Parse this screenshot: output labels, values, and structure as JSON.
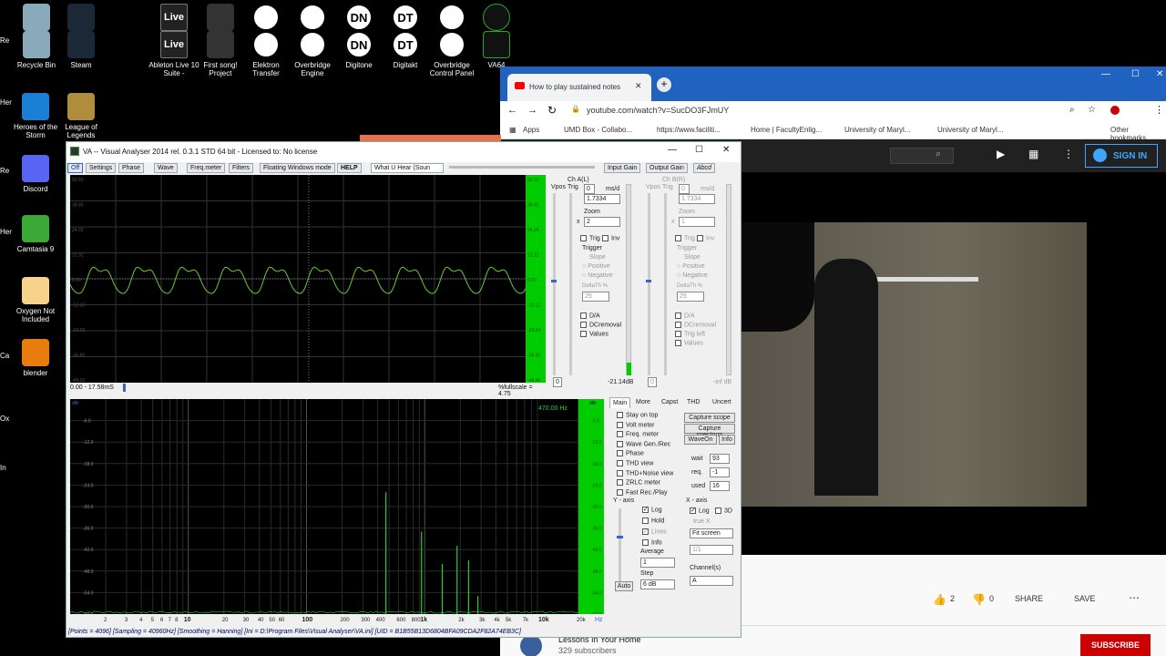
{
  "desktop": {
    "icons": [
      {
        "label": "Recycle Bin",
        "icon": "recycle-bin-icon"
      },
      {
        "label": "Steam",
        "icon": "steam-icon"
      },
      {
        "label": "Ableton Live 10 Suite -",
        "icon": "live-icon",
        "glyph": "Live"
      },
      {
        "label": "First song! Project",
        "icon": "project-file-icon"
      },
      {
        "label": "Elektron Transfer",
        "icon": "waveform-icon"
      },
      {
        "label": "Overbridge Engine",
        "icon": "overbridge-icon"
      },
      {
        "label": "Digitone",
        "icon": "digitone-icon",
        "glyph": "DN"
      },
      {
        "label": "Digitakt",
        "icon": "digitakt-icon",
        "glyph": "DT"
      },
      {
        "label": "Overbridge Control Panel",
        "icon": "control-panel-icon"
      },
      {
        "label": "VA64",
        "icon": "va-icon"
      },
      {
        "label": "Heroes of the Storm",
        "icon": "heroes-icon"
      },
      {
        "label": "League of Legends",
        "icon": "league-icon"
      },
      {
        "label": "Discord",
        "icon": "discord-icon"
      },
      {
        "label": "Camtasia 9",
        "icon": "camtasia-icon"
      },
      {
        "label": "Oxygen Not Included",
        "icon": "oxygen-icon"
      },
      {
        "label": "blender",
        "icon": "blender-icon"
      }
    ],
    "top_row_glyphs": [
      "Live",
      "DN",
      "DT"
    ],
    "edge_labels": [
      "Re",
      "Her",
      "Re",
      "Her",
      "Ca",
      "Ox",
      "In"
    ]
  },
  "browser": {
    "tab_title": "How to play sustained notes",
    "url": "youtube.com/watch?v=SucDO3FJmUY",
    "bookmarks": [
      "Apps",
      "UMD Box - Collabo...",
      "https://www.faciliti...",
      "Home | FacultyEnlig...",
      "University of Maryl...",
      "University of Maryl...",
      "Other bookmarks"
    ],
    "sign_in": "SIGN IN",
    "likes": "2",
    "dislikes": "0",
    "share": "SHARE",
    "save": "SAVE",
    "channel": "Lessons In Your Home",
    "subscribers": "329 subscribers",
    "subscribe": "SUBSCRIBE",
    "colors": {
      "tabbar": "#1f62c0",
      "subscribe": "#cc0000"
    }
  },
  "va": {
    "title": "VA -- Visual Analyser 2014 rel. 0.3.1 STD 64 bit - Licensed to: No license",
    "menu": [
      "Off",
      "Settings",
      "Phase",
      "Wave",
      "Freq.meter",
      "Filters",
      "Floating Windows mode",
      "HELP",
      "What U Hear (Soun"
    ],
    "gain_buttons": [
      "Input Gain",
      "Output Gain",
      "Abcd"
    ],
    "scope": {
      "time_range": "0.00 - 17.58mS",
      "fullscale": "%fullscale = 4.75",
      "y_ticks": [
        "59.50",
        "38.80",
        "24.02",
        "12.32",
        "0.00",
        "-12.32",
        "-24.03",
        "-36.89",
        "-49.02"
      ],
      "right_ticks": [
        "55.50",
        "38.42",
        "24.24",
        "12.12",
        "0.00",
        "-12.12",
        "-24.24",
        "-36.31",
        "-48.49"
      ]
    },
    "chA": {
      "label": "Ch A(L)",
      "vpos": "Vpos",
      "trig": "Trig",
      "value0": "0",
      "ms_d": "ms/d",
      "msd": "1.7334",
      "zoom": "Zoom",
      "zoom_x": "x",
      "zoom_val": "2",
      "trig_label": "Trig",
      "inv": "Inv",
      "trigger": "Trigger",
      "slope": "Slope",
      "positive": "Positive",
      "negative": "Negative",
      "delta": "DeltaTh %",
      "delta_val": "25",
      "da": "D/A",
      "dc": "DCremoval",
      "values": "Values",
      "zero": "0",
      "db": "-21.14dB"
    },
    "chB": {
      "label": "Ch B(R)",
      "vpos": "Vpos",
      "trig": "Trig",
      "value0": "0",
      "ms_d": "ms/d",
      "msd": "1.7334",
      "zoom": "Zoom",
      "zoom_x": "x",
      "zoom_val": "1",
      "trig_label": "Trig",
      "inv": "Inv",
      "trigger": "Trigger",
      "slope": "Slope",
      "positive": "Positive",
      "negative": "Negative",
      "delta": "DeltaTh %",
      "delta_val": "25",
      "da": "D/A",
      "dc": "DCremoval",
      "trig_left": "Trig left",
      "values": "Values",
      "zero": "0",
      "db": "-inf dB"
    },
    "spectrum": {
      "peak_label": "470.00 Hz",
      "db_label": "dBr",
      "y_ticks": [
        "-6.0",
        "-12.0",
        "-18.0",
        "-24.0",
        "-30.0",
        "-36.0",
        "-42.0",
        "-48.0",
        "-54.0",
        "-60.0"
      ],
      "x_ticks": [
        "2",
        "3",
        "4",
        "5",
        "6",
        "7",
        "8",
        "10",
        "20",
        "30",
        "40",
        "50",
        "60",
        "100",
        "200",
        "300",
        "400",
        "600",
        "800",
        "1k",
        "2k",
        "3k",
        "4k",
        "5k",
        "7k",
        "10k",
        "20k"
      ],
      "hz": "Hz"
    },
    "tabs": [
      "Main",
      "More",
      "Capst",
      "THD",
      "Uncert"
    ],
    "main_checks": [
      "Stay on top",
      "Volt meter",
      "Freq. meter",
      "Wave Gen./Rec",
      "Phase",
      "THD view",
      "THD+Noise view",
      "ZRLC meter",
      "Fast Rec./Play"
    ],
    "capture_buttons": [
      "Capture scope",
      "Capture spectrum",
      "WaveOn",
      "Info"
    ],
    "wait": {
      "wait": "wait",
      "wait_val": "93",
      "req": "req.",
      "req_val": "-1",
      "used": "used",
      "used_val": "16"
    },
    "yaxis": {
      "title": "Y - axis",
      "log": "Log",
      "hold": "Hold",
      "lines": "Lines",
      "info": "Info",
      "average": "Average",
      "average_val": "1",
      "step": "Step",
      "step_val": "6 dB",
      "auto": "Auto"
    },
    "xaxis": {
      "title": "X - axis",
      "log": "Log",
      "threeD": "3D",
      "true": "true X",
      "fit": "Fit screen",
      "ratio": "1/1",
      "channels": "Channel(s)",
      "channel_val": "A"
    },
    "status": "[Points = 4096]  [Sampling = 40960Hz]  [Smoothing = Hanning]  [Ini = D:\\Program Files\\Visual Analyser\\VA.ini]  [UID = B1B55B13D6804BFA09CDA2F82A74EB3C]"
  },
  "chart_data": {
    "type": "bar",
    "title": "",
    "xlabel": "Hz",
    "ylabel": "dBr",
    "x_scale": "log",
    "ylim": [
      -60,
      0
    ],
    "x": [
      470,
      940,
      1410,
      1880,
      2350,
      2820
    ],
    "values": [
      -26,
      -37,
      -46,
      -41,
      -45,
      -55
    ]
  }
}
